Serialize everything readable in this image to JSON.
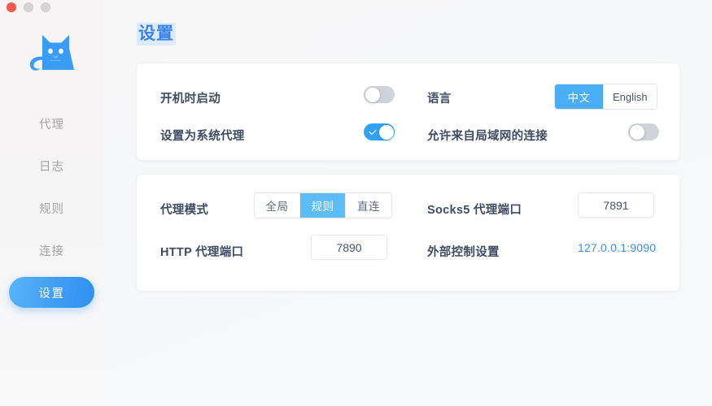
{
  "window": {
    "traffic_lights": [
      "close",
      "minimize",
      "maximize"
    ]
  },
  "sidebar": {
    "logo": "clash-cat-logo",
    "items": [
      {
        "label": "代理",
        "name": "proxies",
        "active": false
      },
      {
        "label": "日志",
        "name": "logs",
        "active": false
      },
      {
        "label": "规则",
        "name": "rules",
        "active": false
      },
      {
        "label": "连接",
        "name": "connections",
        "active": false
      },
      {
        "label": "设置",
        "name": "settings",
        "active": true
      }
    ]
  },
  "main": {
    "page_title": "设置",
    "cards": {
      "general": {
        "start_on_boot": {
          "label": "开机时启动",
          "state": "off"
        },
        "system_proxy": {
          "label": "设置为系统代理",
          "state": "on"
        },
        "language": {
          "label": "语言",
          "options": [
            "中文",
            "English"
          ],
          "selected": "中文"
        },
        "allow_lan": {
          "label": "允许来自局域网的连接",
          "state": "off"
        }
      },
      "proxy": {
        "proxy_mode": {
          "label": "代理模式",
          "options": [
            "全局",
            "规则",
            "直连"
          ],
          "selected": "规则"
        },
        "http_port": {
          "label": "HTTP 代理端口",
          "value": "7890",
          "placeholder": "7890"
        },
        "socks5_port": {
          "label": "Socks5 代理端口",
          "value": "7891",
          "placeholder": "7891"
        },
        "external_controller": {
          "label": "外部控制设置",
          "value": "127.0.0.1:9090"
        }
      }
    }
  },
  "colors": {
    "accent": "#3b82e8",
    "toggle_on": "#31a2f2",
    "segment_selected": "#5cbcf6",
    "link": "#3b8ce8",
    "label": "#3e4c63",
    "sidebar_inactive": "#a3a3a6",
    "logo": "#3b9cf5"
  }
}
